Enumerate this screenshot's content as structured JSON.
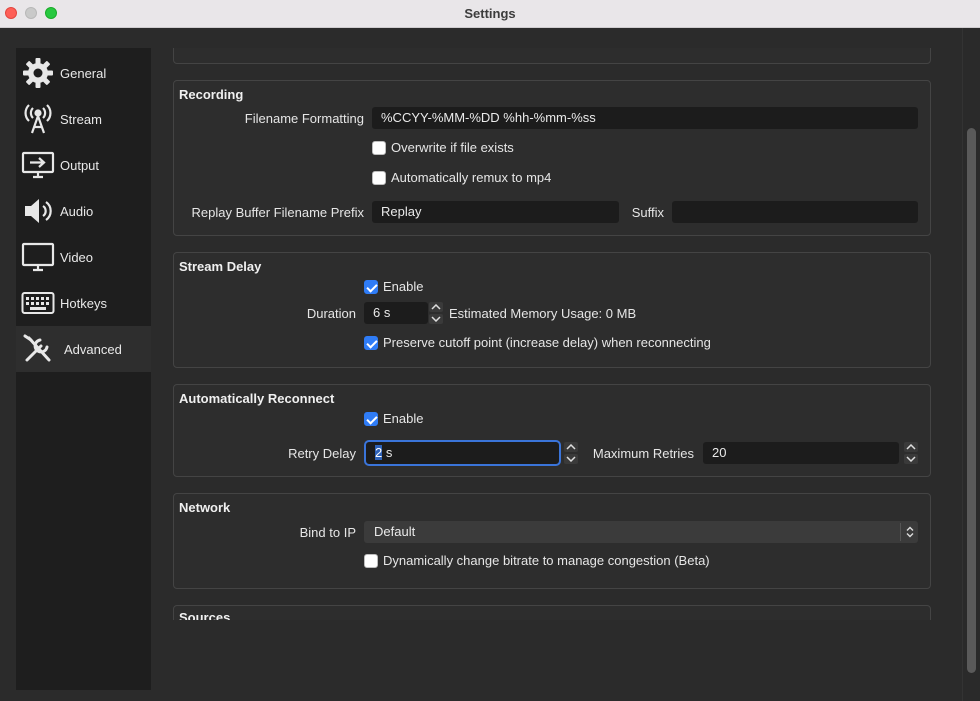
{
  "window": {
    "title": "Settings"
  },
  "sidebar": {
    "items": [
      {
        "label": "General",
        "icon": "gear-icon"
      },
      {
        "label": "Stream",
        "icon": "antenna-icon"
      },
      {
        "label": "Output",
        "icon": "output-icon"
      },
      {
        "label": "Audio",
        "icon": "speaker-icon"
      },
      {
        "label": "Video",
        "icon": "monitor-icon"
      },
      {
        "label": "Hotkeys",
        "icon": "keyboard-icon"
      },
      {
        "label": "Advanced",
        "icon": "tools-icon",
        "active": true
      }
    ]
  },
  "recording": {
    "title": "Recording",
    "filename_label": "Filename Formatting",
    "filename_value": "%CCYY-%MM-%DD %hh-%mm-%ss",
    "overwrite_label": "Overwrite if file exists",
    "overwrite_checked": false,
    "remux_label": "Automatically remux to mp4",
    "remux_checked": false,
    "replay_prefix_label": "Replay Buffer Filename Prefix",
    "replay_prefix_value": "Replay",
    "suffix_label": "Suffix",
    "suffix_value": ""
  },
  "stream_delay": {
    "title": "Stream Delay",
    "enable_label": "Enable",
    "enable_checked": true,
    "duration_label": "Duration",
    "duration_value": "6 s",
    "memory_usage": "Estimated Memory Usage: 0 MB",
    "preserve_label": "Preserve cutoff point (increase delay) when reconnecting",
    "preserve_checked": true
  },
  "auto_reconnect": {
    "title": "Automatically Reconnect",
    "enable_label": "Enable",
    "enable_checked": true,
    "retry_delay_label": "Retry Delay",
    "retry_delay_selected": "2",
    "retry_delay_rest": " s",
    "max_retries_label": "Maximum Retries",
    "max_retries_value": "20"
  },
  "network": {
    "title": "Network",
    "bind_label": "Bind to IP",
    "bind_value": "Default",
    "dynamic_bitrate_label": "Dynamically change bitrate to manage congestion (Beta)",
    "dynamic_bitrate_checked": false
  },
  "sources": {
    "title": "Sources"
  },
  "colors": {
    "accent": "#2f7cf6",
    "sidebar_bg": "#1e1e1e",
    "panel_bg": "#2b2b2b"
  }
}
